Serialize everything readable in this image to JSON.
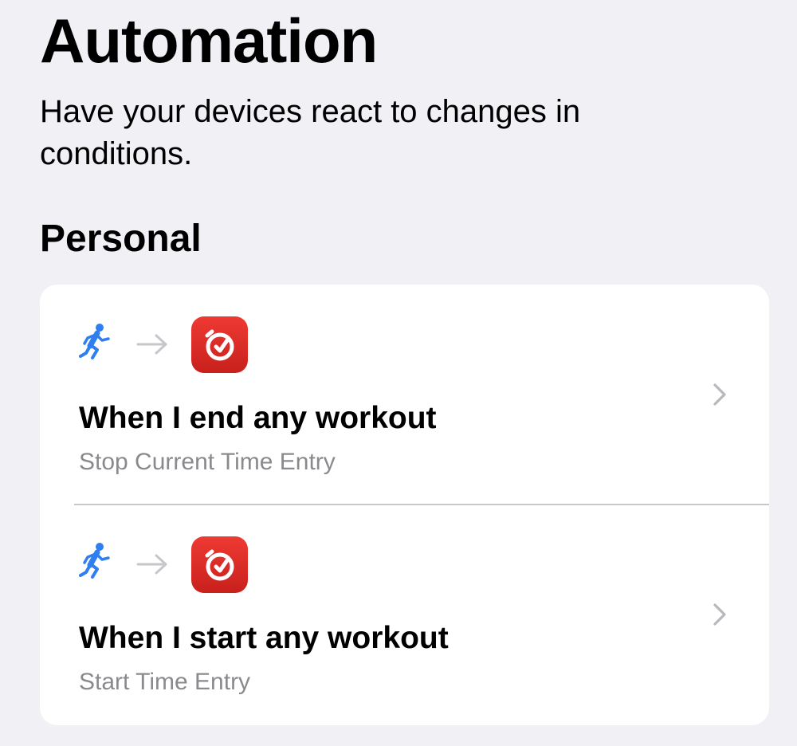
{
  "header": {
    "title": "Automation",
    "subtitle": "Have your devices react to changes in conditions."
  },
  "section": {
    "title": "Personal"
  },
  "automations": [
    {
      "trigger_icon": "running-figure-icon",
      "connector_icon": "arrow-right-icon",
      "app_icon": "timer-app-icon",
      "title": "When I end any workout",
      "action": "Stop Current Time Entry"
    },
    {
      "trigger_icon": "running-figure-icon",
      "connector_icon": "arrow-right-icon",
      "app_icon": "timer-app-icon",
      "title": "When I start any workout",
      "action": "Start Time Entry"
    }
  ],
  "colors": {
    "background": "#f0f0f5",
    "card": "#ffffff",
    "trigger_icon": "#2f7ff0",
    "app_icon": "#e0302a",
    "secondary_text": "#8a8a8e",
    "chevron": "#b8b8bd"
  }
}
